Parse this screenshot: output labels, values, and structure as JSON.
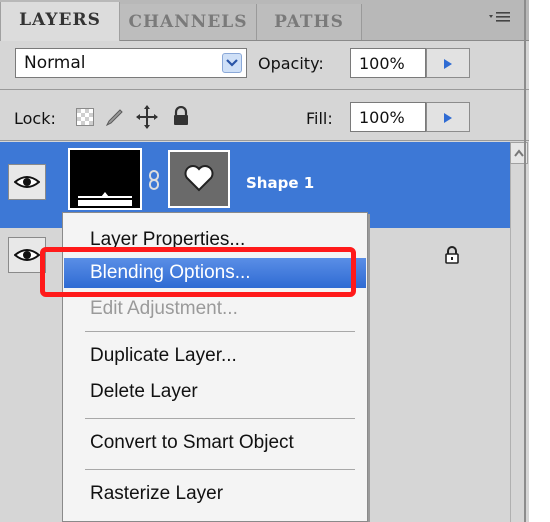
{
  "tabs": [
    {
      "label": "LAYERS",
      "active": true
    },
    {
      "label": "CHANNELS",
      "active": false
    },
    {
      "label": "PATHS",
      "active": false
    }
  ],
  "panel_menu_icon": "panel-menu-icon",
  "blend": {
    "mode_value": "Normal",
    "opacity_label": "Opacity:",
    "opacity_value": "100%"
  },
  "lock": {
    "label": "Lock:",
    "icons": [
      "lock-transparent-pixels-icon",
      "lock-image-pixels-icon",
      "lock-position-icon",
      "lock-all-icon"
    ],
    "fill_label": "Fill:",
    "fill_value": "100%"
  },
  "layers": [
    {
      "name": "Shape 1",
      "selected": true
    },
    {
      "name": "",
      "selected": false,
      "locked": true
    }
  ],
  "context_menu": {
    "items": [
      {
        "label": "Layer Properties...",
        "enabled": true,
        "highlighted": false
      },
      {
        "label": "Blending Options...",
        "enabled": true,
        "highlighted": true
      },
      {
        "label": "Edit Adjustment...",
        "enabled": false,
        "highlighted": false
      },
      {
        "label": "Duplicate Layer...",
        "enabled": true,
        "highlighted": false
      },
      {
        "label": "Delete Layer",
        "enabled": true,
        "highlighted": false
      },
      {
        "label": "Convert to Smart Object",
        "enabled": true,
        "highlighted": false
      },
      {
        "label": "Rasterize Layer",
        "enabled": true,
        "highlighted": false
      }
    ]
  },
  "colors": {
    "selection_blue": "#3d78d6",
    "menu_highlight": "#2f6bd3",
    "callout_red": "#ff1a1a",
    "panel_gray": "#d6d6d6"
  }
}
